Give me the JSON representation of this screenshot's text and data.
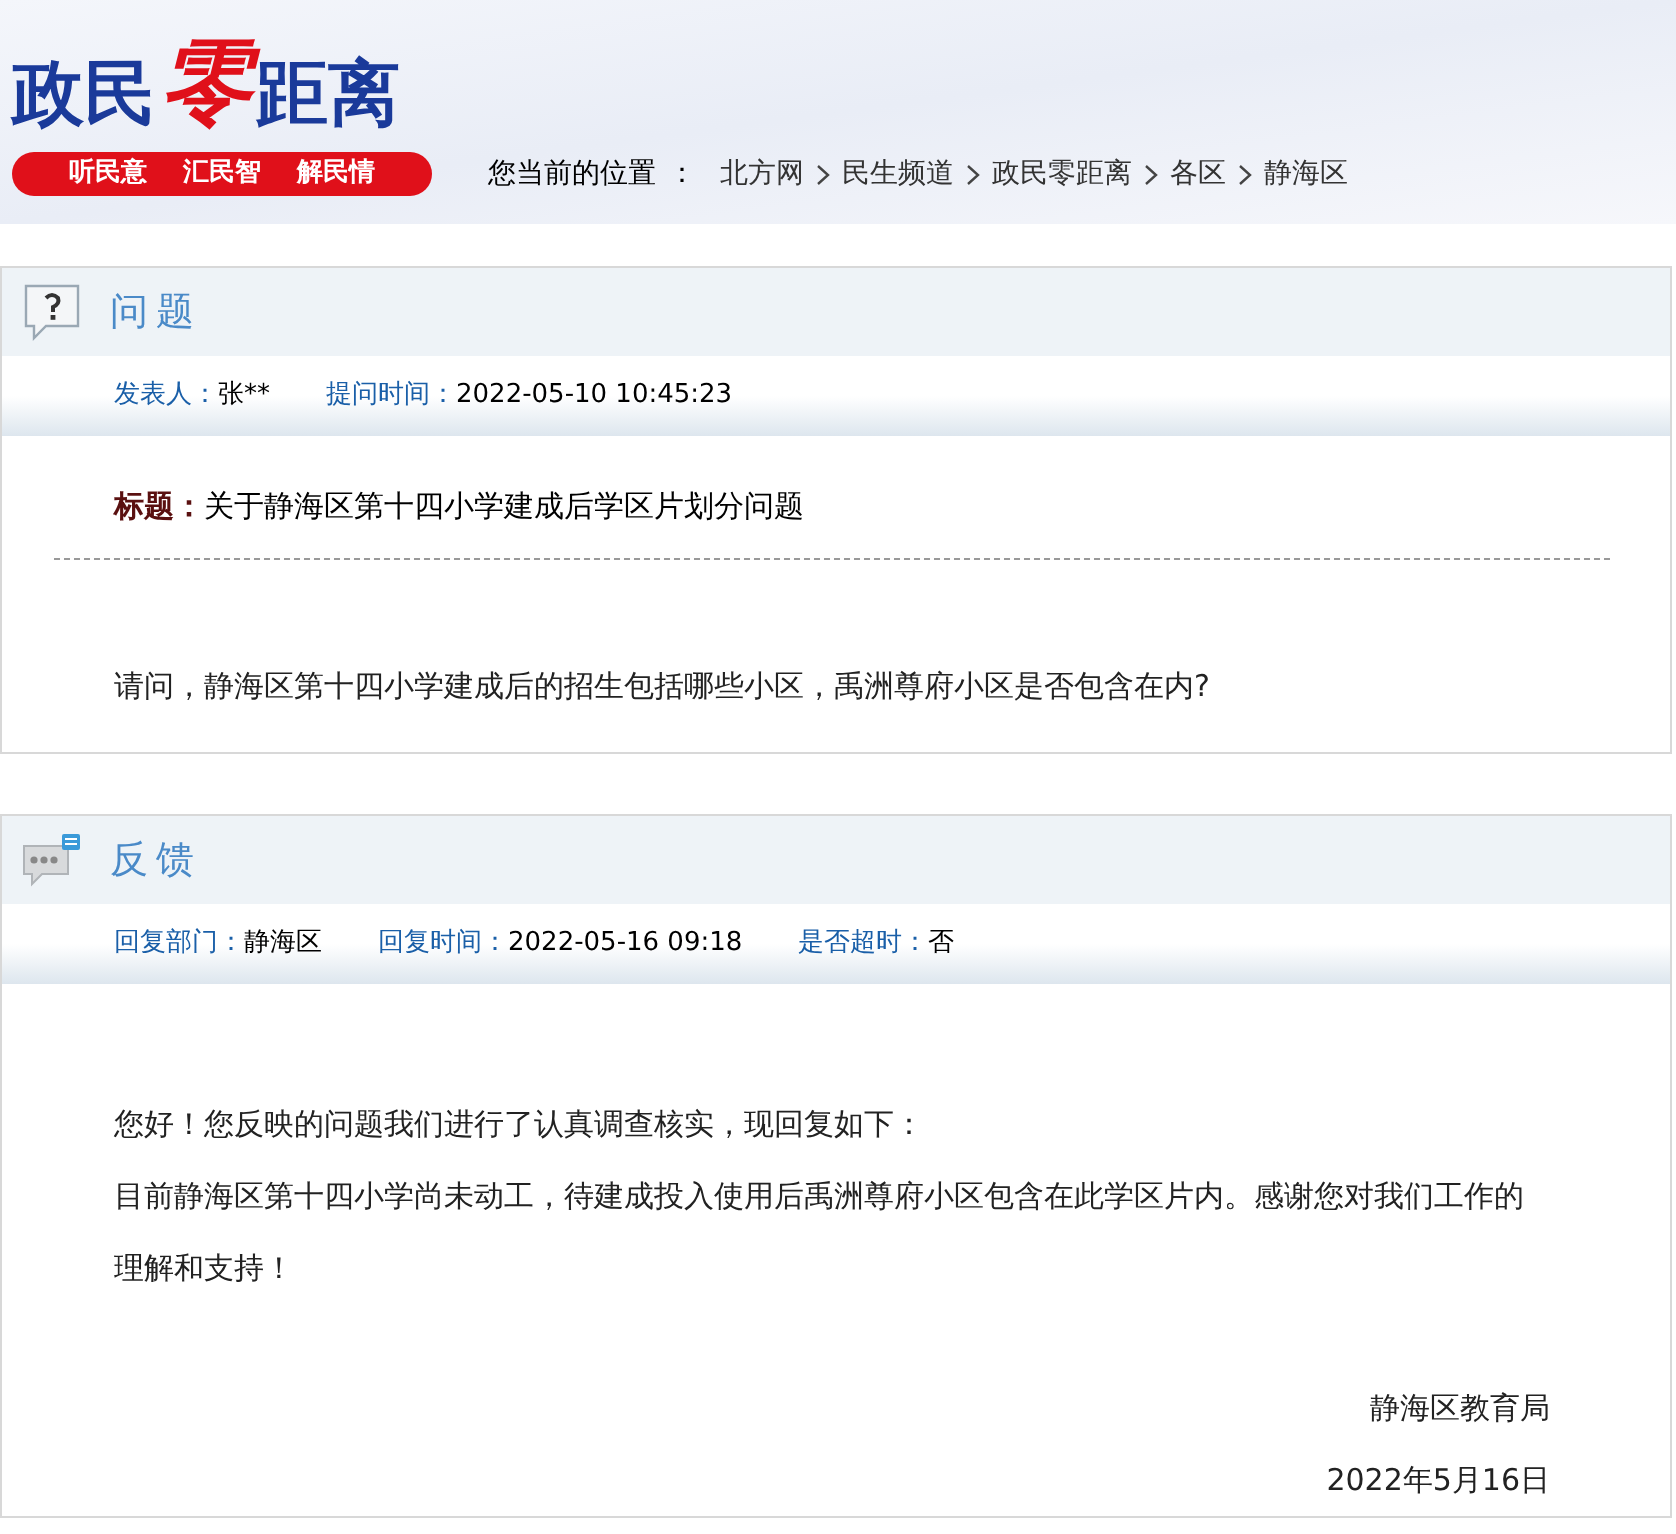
{
  "header": {
    "logo": [
      "政民",
      "零",
      "距离"
    ],
    "slogans": [
      "听民意",
      "汇民智",
      "解民情"
    ],
    "breadcrumb": {
      "label": "您当前的位置",
      "colon": "：",
      "items": [
        "北方网",
        "民生频道",
        "政民零距离",
        "各区",
        "静海区"
      ]
    }
  },
  "question": {
    "heading": "问题",
    "kind": "question",
    "meta": [
      {
        "label": "发表人：",
        "value": "张**"
      },
      {
        "label": "提问时间：",
        "value": "2022-05-10 10:45:23"
      }
    ],
    "title_label": "标题：",
    "title": "关于静海区第十四小学建成后学区片划分问题",
    "paragraphs": [
      "请问，静海区第十四小学建成后的招生包括哪些小区，禹洲尊府小区是否包含在内?"
    ]
  },
  "feedback": {
    "heading": "反馈",
    "kind": "reply",
    "meta": [
      {
        "label": "回复部门：",
        "value": "静海区"
      },
      {
        "label": "回复时间：",
        "value": "2022-05-16 09:18"
      },
      {
        "label": "是否超时：",
        "value": "否"
      }
    ],
    "paragraphs": [
      "您好！您反映的问题我们进行了认真调查核实，现回复如下：",
      "目前静海区第十四小学尚未动工，待建成投入使用后禹洲尊府小区包含在此学区片内。感谢您对我们工作的理解和支持！"
    ],
    "signature": "静海区教育局",
    "date": "2022年5月16日"
  }
}
